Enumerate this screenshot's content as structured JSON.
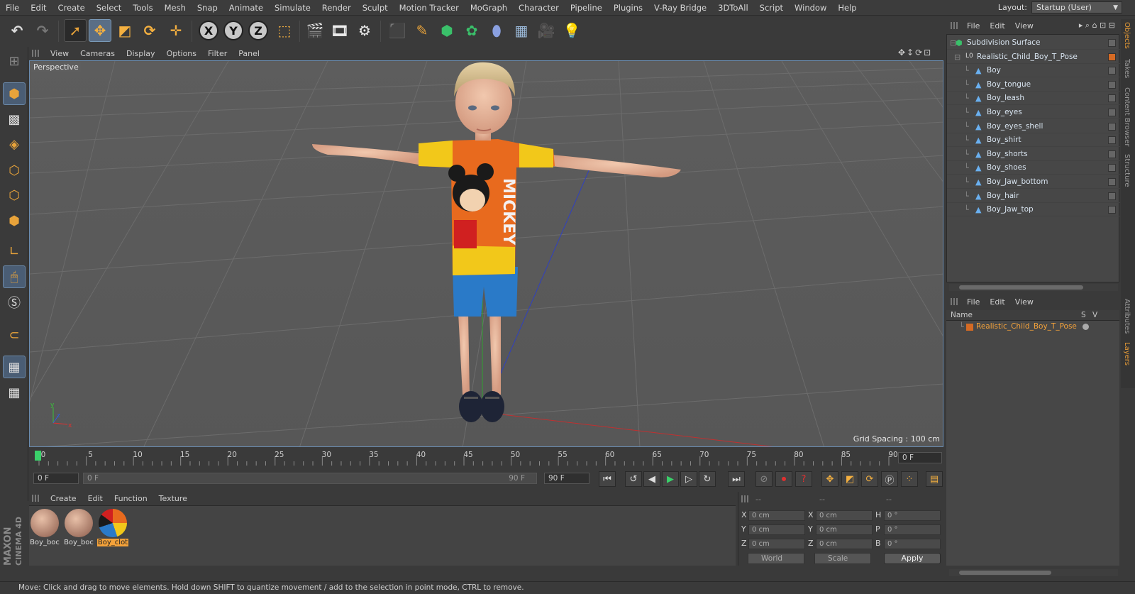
{
  "menubar": {
    "items": [
      "File",
      "Edit",
      "Create",
      "Select",
      "Tools",
      "Mesh",
      "Snap",
      "Animate",
      "Simulate",
      "Render",
      "Sculpt",
      "Motion Tracker",
      "MoGraph",
      "Character",
      "Pipeline",
      "Plugins",
      "V-Ray Bridge",
      "3DToAll",
      "Script",
      "Window",
      "Help"
    ],
    "layout_label": "Layout:",
    "layout_value": "Startup (User)"
  },
  "toolbar": {
    "axis_x": "X",
    "axis_y": "Y",
    "axis_z": "Z"
  },
  "viewport": {
    "menu": [
      "View",
      "Cameras",
      "Display",
      "Options",
      "Filter",
      "Panel"
    ],
    "label": "Perspective",
    "grid_spacing": "Grid Spacing : 100 cm",
    "shirt_text": "MICKEY"
  },
  "timeline": {
    "ticks": [
      "0",
      "5",
      "10",
      "15",
      "20",
      "25",
      "30",
      "35",
      "40",
      "45",
      "50",
      "55",
      "60",
      "65",
      "70",
      "75",
      "80",
      "85",
      "90"
    ],
    "current_frame": "0 F"
  },
  "transport": {
    "start_field": "0 F",
    "range_start": "0 F",
    "range_end": "90 F",
    "end_field": "90 F"
  },
  "material_manager": {
    "menu": [
      "Create",
      "Edit",
      "Function",
      "Texture"
    ],
    "materials": [
      {
        "label": "Boy_boc",
        "selected": false
      },
      {
        "label": "Boy_boc",
        "selected": false
      },
      {
        "label": "Boy_clot",
        "selected": true
      }
    ]
  },
  "coords": {
    "header": [
      "--",
      "--",
      "--"
    ],
    "rows": [
      {
        "a": "X",
        "av": "0 cm",
        "b": "X",
        "bv": "0 cm",
        "c": "H",
        "cv": "0 °"
      },
      {
        "a": "Y",
        "av": "0 cm",
        "b": "Y",
        "bv": "0 cm",
        "c": "P",
        "cv": "0 °"
      },
      {
        "a": "Z",
        "av": "0 cm",
        "b": "Z",
        "bv": "0 cm",
        "c": "B",
        "cv": "0 °"
      }
    ],
    "mode": "World",
    "scale": "Scale",
    "apply": "Apply"
  },
  "brand": {
    "line1": "MAXON",
    "line2": "CINEMA 4D"
  },
  "status": "Move: Click and drag to move elements. Hold down SHIFT to quantize movement / add to the selection in point mode, CTRL to remove.",
  "object_manager": {
    "menu": [
      "File",
      "Edit",
      "View"
    ],
    "objects": [
      {
        "name": "Subdivision Surface",
        "level": 0
      },
      {
        "name": "Realistic_Child_Boy_T_Pose",
        "level": 1
      },
      {
        "name": "Boy",
        "level": 2
      },
      {
        "name": "Boy_tongue",
        "level": 2
      },
      {
        "name": "Boy_leash",
        "level": 2
      },
      {
        "name": "Boy_eyes",
        "level": 2
      },
      {
        "name": "Boy_eyes_shell",
        "level": 2
      },
      {
        "name": "Boy_shirt",
        "level": 2
      },
      {
        "name": "Boy_shorts",
        "level": 2
      },
      {
        "name": "Boy_shoes",
        "level": 2
      },
      {
        "name": "Boy_Jaw_bottom",
        "level": 2
      },
      {
        "name": "Boy_hair",
        "level": 2
      },
      {
        "name": "Boy_Jaw_top",
        "level": 2
      }
    ]
  },
  "layers_manager": {
    "menu": [
      "File",
      "Edit",
      "View"
    ],
    "col_name": "Name",
    "col_s": "S",
    "col_v": "V",
    "layer": "Realistic_Child_Boy_T_Pose"
  },
  "right_tabs": [
    "Objects",
    "Takes",
    "Content Browser",
    "Structure",
    "Attributes",
    "Layers"
  ],
  "colors": {
    "accent": "#f4a23a",
    "selection": "#6a8cb0",
    "layer_text": "#f4a23a"
  }
}
